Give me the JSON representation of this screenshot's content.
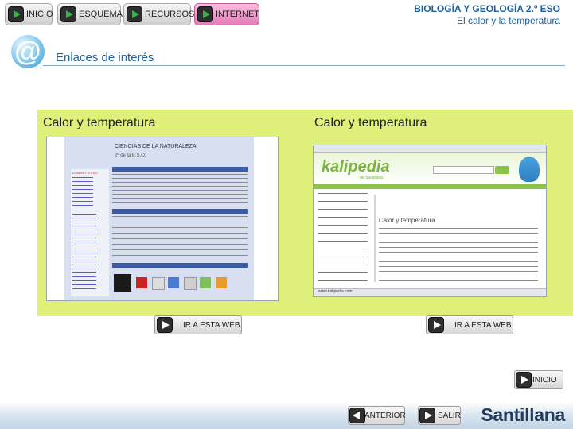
{
  "nav": {
    "items": [
      {
        "label": "INICIO"
      },
      {
        "label": "ESQUEMA"
      },
      {
        "label": "RECURSOS"
      },
      {
        "label": "INTERNET"
      }
    ]
  },
  "header": {
    "title": "BIOLOGÍA Y GEOLOGÍA 2.º ESO",
    "subtitle": "El calor y la temperatura"
  },
  "section": {
    "title": "Enlaces de interés",
    "icon": "at-sign-icon"
  },
  "panels": [
    {
      "title": "Calor y temperatura",
      "button": "IR A ESTA WEB"
    },
    {
      "title": "Calor y temperatura",
      "button": "IR A ESTA WEB"
    }
  ],
  "shot1": {
    "heading1": "CIENCIAS DE LA NATURALEZA",
    "heading2": "2º de la E.S.O.",
    "side_title": "Lourdes F. 2 ESO"
  },
  "shot2": {
    "brand": "kalipedia",
    "brand_sub": "de Santillana",
    "article_title": "Calor y temperatura",
    "status": "www.kalipedia.com"
  },
  "bottom": {
    "inicio": "INICIO",
    "anterior": "ANTERIOR",
    "salir": "SALIR",
    "brand": "Santillana"
  }
}
